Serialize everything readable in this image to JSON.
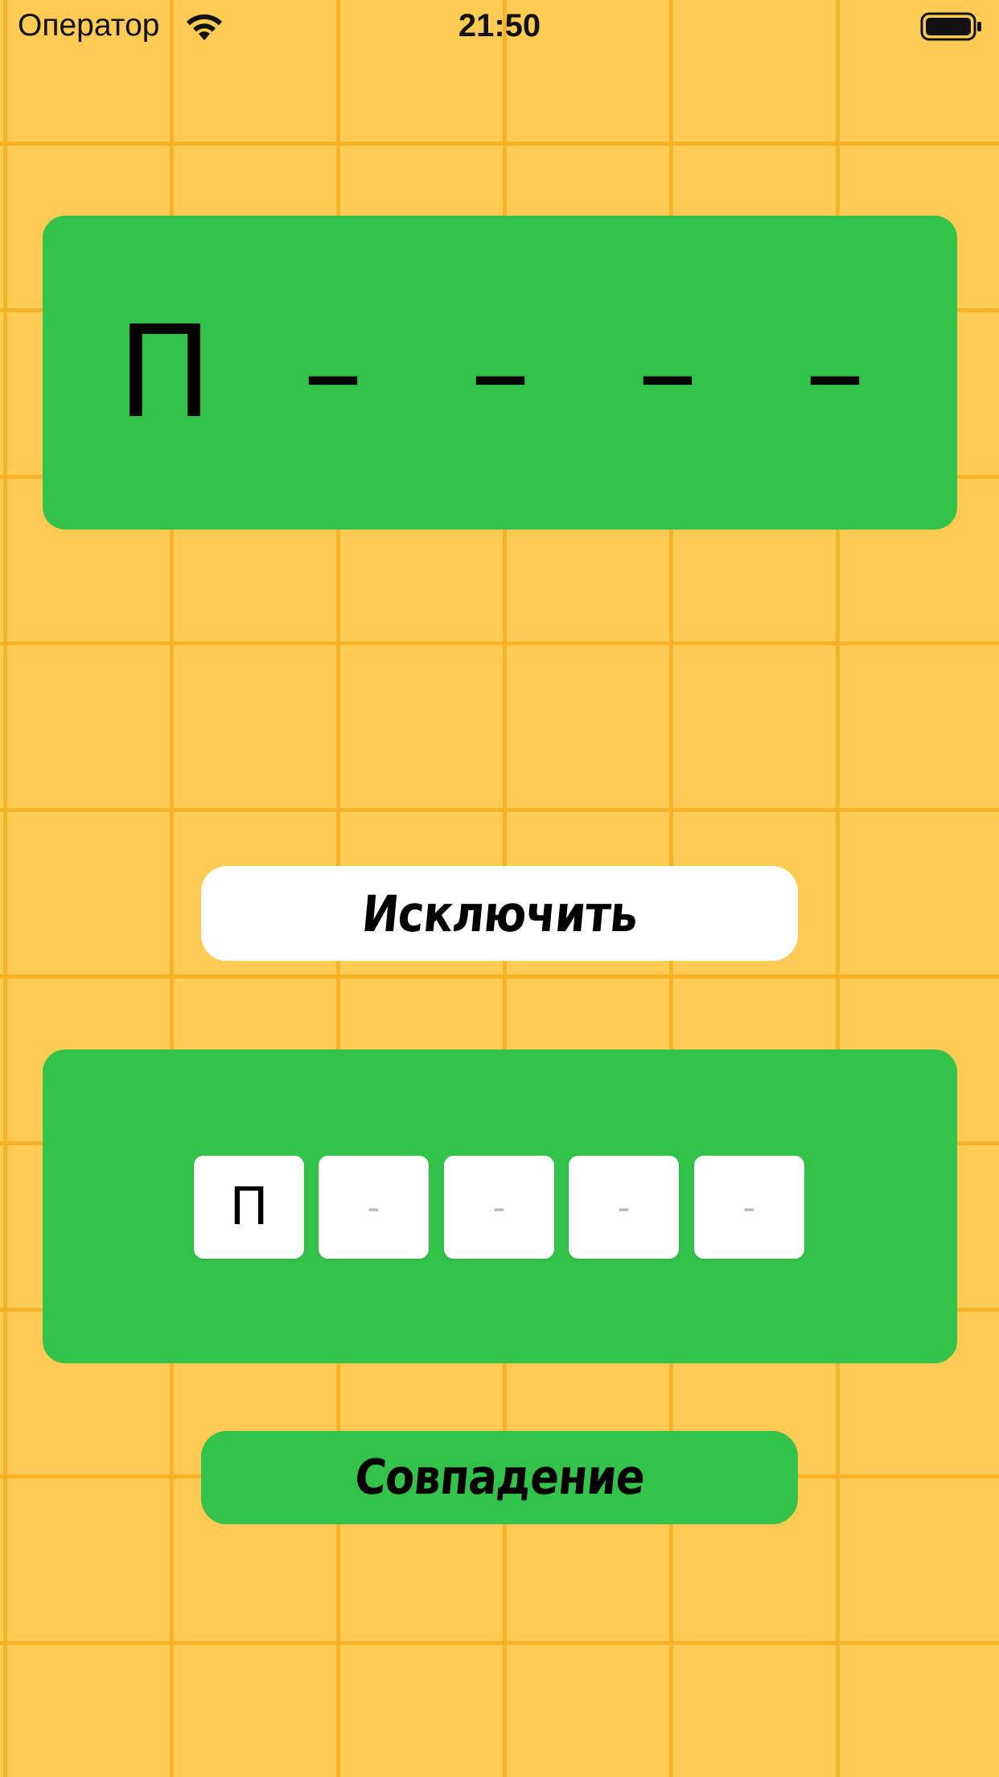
{
  "status_bar": {
    "carrier": "Оператор",
    "time": "21:50"
  },
  "word_panel": {
    "slots": [
      "П",
      "–",
      "–",
      "–",
      "–"
    ]
  },
  "exclude_button": {
    "label": "Исключить"
  },
  "input_panel": {
    "boxes": [
      "П",
      "-",
      "-",
      "-",
      "-"
    ]
  },
  "match_button": {
    "label": "Совпадение"
  },
  "colors": {
    "background": "#FFCB52",
    "grid_line": "#F5AF23",
    "panel_green": "#33C24A",
    "white": "#FFFFFF"
  }
}
